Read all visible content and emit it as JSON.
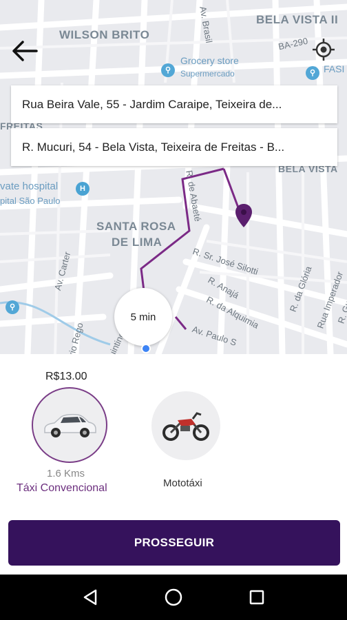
{
  "map": {
    "districts": {
      "wilson_brito": "WILSON BRITO",
      "bela_vista_ii": "BELA VISTA II",
      "bela_vista": "BELA VISTA",
      "santa_rosa_1": "SANTA ROSA",
      "santa_rosa_2": "DE LIMA"
    },
    "streets": {
      "av_brasil": "Av. Brasil",
      "ba290": "BA-290",
      "jose_silotti": "R. Sr. José Silotti",
      "anaja": "R. Anajá",
      "alquimia": "R. da Alquimia",
      "paulo": "Av. Paulo S",
      "gloria": "R. da Glória",
      "imperador": "Rua Imperador",
      "guarabira": "R. Guarabi",
      "carter": "Av. Carter",
      "rogerio": "Rogério Rego",
      "quintino": "R. Quintino Lima",
      "abaete": "R. de Abaeté",
      "freitas": "FREITAS"
    },
    "pois": {
      "grocery_1": "Grocery store",
      "grocery_2": "Supermercado",
      "hospital_1": "vate hospital",
      "hospital_2": "pital São Paulo",
      "fas": "FASI"
    },
    "eta": "5 min"
  },
  "route": {
    "origin": "Rua Beira Vale, 55 - Jardim Caraipe, Teixeira de...",
    "destination": "R. Mucuri, 54 - Bela Vista, Teixeira de Freitas - B..."
  },
  "options": {
    "price": "R$13.00",
    "car": {
      "distance": "1.6 Kms",
      "label": "Táxi Convencional"
    },
    "moto": {
      "label": "Mototáxi"
    }
  },
  "actions": {
    "proceed": "PROSSEGUIR"
  },
  "colors": {
    "accent": "#35125c",
    "selected_border": "#7a3d87",
    "route": "#7b2a86"
  }
}
